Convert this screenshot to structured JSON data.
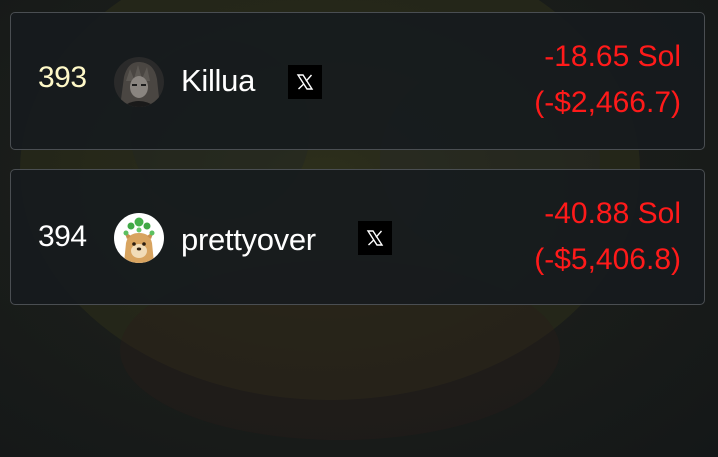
{
  "colors": {
    "negative": "#ff1a1a",
    "rank_default": "#ffffff",
    "rank_gold": "#fff9c8",
    "name": "#ffffff"
  },
  "rows": [
    {
      "rank": "393",
      "name": "Killua",
      "social_icon": "x-logo-icon",
      "pnl_sol": "-18.65 Sol",
      "pnl_usd": "(-$2,466.7)"
    },
    {
      "rank": "394",
      "name": "prettyover",
      "social_icon": "x-logo-icon",
      "pnl_sol": "-40.88 Sol",
      "pnl_usd": "(-$5,406.8)"
    }
  ]
}
